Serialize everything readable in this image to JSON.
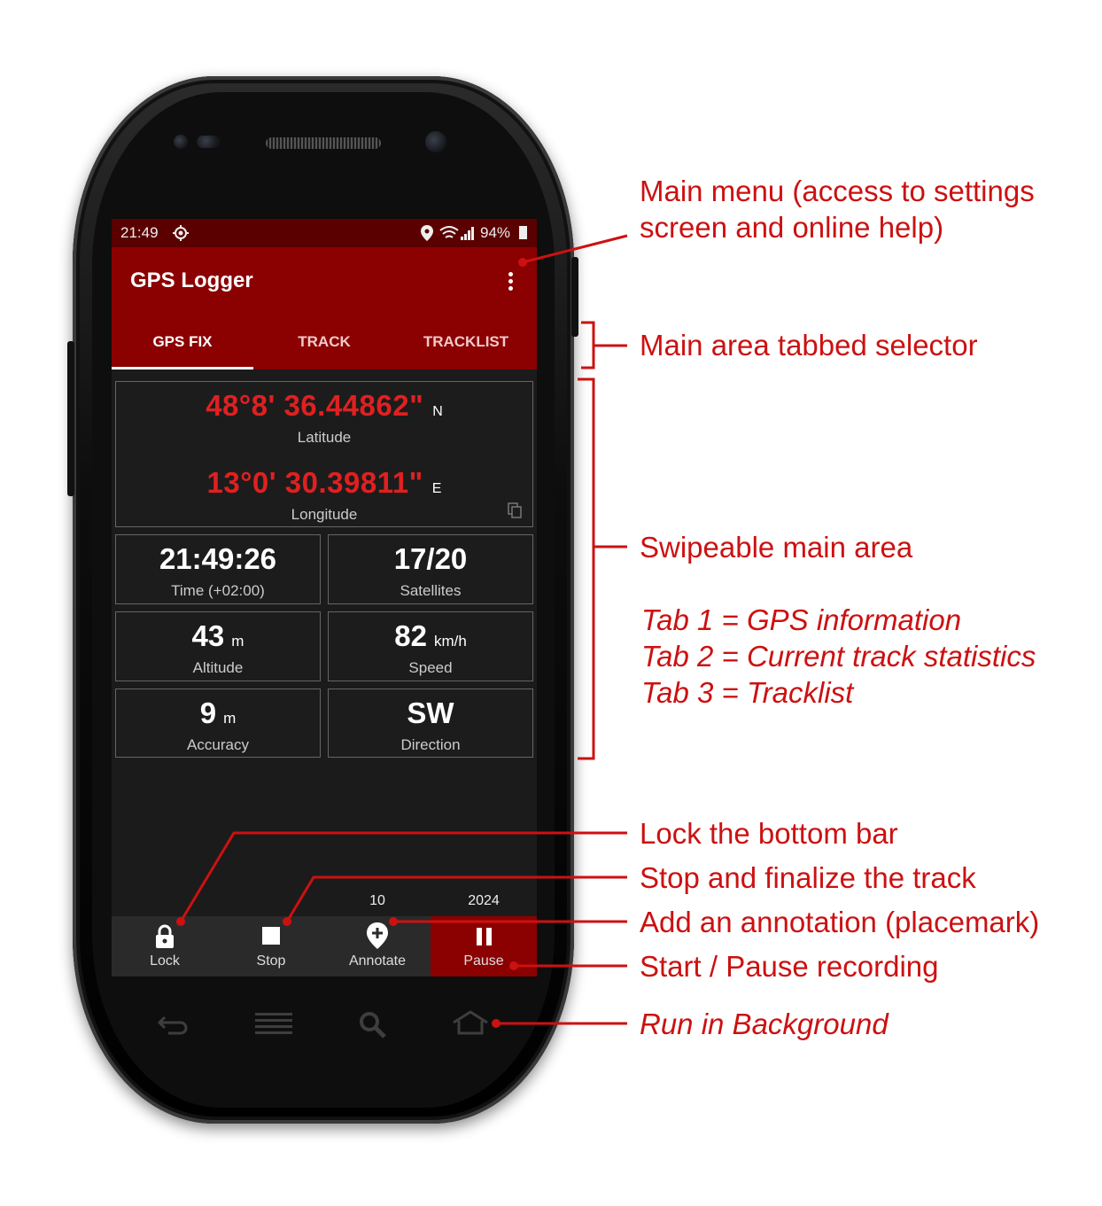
{
  "status_bar": {
    "time": "21:49",
    "battery": "94%"
  },
  "app": {
    "title": "GPS Logger"
  },
  "tabs": [
    {
      "label": "GPS FIX",
      "active": true
    },
    {
      "label": "TRACK",
      "active": false
    },
    {
      "label": "TRACKLIST",
      "active": false
    }
  ],
  "fix": {
    "latitude": {
      "value": "48°8' 36.44862\"",
      "hemisphere": "N",
      "label": "Latitude"
    },
    "longitude": {
      "value": "13°0' 30.39811\"",
      "hemisphere": "E",
      "label": "Longitude"
    },
    "time": {
      "value": "21:49:26",
      "label": "Time (+02:00)"
    },
    "satellites": {
      "value": "17/20",
      "label": "Satellites"
    },
    "altitude": {
      "value": "43",
      "unit": "m",
      "label": "Altitude"
    },
    "speed": {
      "value": "82",
      "unit": "km/h",
      "label": "Speed"
    },
    "accuracy": {
      "value": "9",
      "unit": "m",
      "label": "Accuracy"
    },
    "direction": {
      "value": "SW",
      "label": "Direction"
    }
  },
  "counters": {
    "annotations": "10",
    "points": "2024"
  },
  "bottom_bar": [
    {
      "label": "Lock",
      "icon": "lock-icon"
    },
    {
      "label": "Stop",
      "icon": "stop-icon"
    },
    {
      "label": "Annotate",
      "icon": "add-placemark-icon"
    },
    {
      "label": "Pause",
      "icon": "pause-icon"
    }
  ],
  "annotations": {
    "main_menu": "Main menu (access to settings",
    "main_menu_2": "screen and online help)",
    "tab_selector": "Main area tabbed selector",
    "swipe_area": "Swipeable main area",
    "tab1": "Tab 1 = GPS information",
    "tab2": "Tab 2 = Current track statistics",
    "tab3": "Tab 3 = Tracklist",
    "lock": "Lock the bottom bar",
    "stop": "Stop and finalize the track",
    "annotate": "Add an annotation (placemark)",
    "pause": "Start / Pause recording",
    "background": "Run in Background"
  },
  "colors": {
    "accent": "#8b0000",
    "status": "#5a0000",
    "annotation": "#cc1111",
    "coord": "#e02020"
  }
}
